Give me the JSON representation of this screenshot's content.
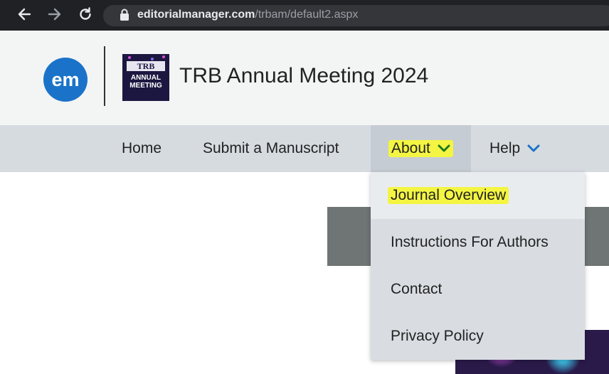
{
  "browser": {
    "url_host": "editorialmanager.com",
    "url_path": "/trbam/default2.aspx"
  },
  "header": {
    "em_logo_text": "em",
    "trb_logo_word": "TRB",
    "trb_logo_sub": "ANNUAL MEETING",
    "title": "TRB Annual Meeting 2024"
  },
  "nav": {
    "items": [
      {
        "label": "Home"
      },
      {
        "label": "Submit a Manuscript"
      },
      {
        "label": "About"
      },
      {
        "label": "Help"
      }
    ]
  },
  "about_menu": {
    "items": [
      {
        "label": "Journal Overview"
      },
      {
        "label": "Instructions For Authors"
      },
      {
        "label": "Contact"
      },
      {
        "label": "Privacy Policy"
      }
    ]
  },
  "colors": {
    "highlight": "#f4f542",
    "nav_bg": "#d6dbe0",
    "accent_chevron": "#1a73c8"
  },
  "icons": [
    "back-arrow-icon",
    "forward-arrow-icon",
    "reload-icon",
    "lock-icon",
    "chevron-down-icon"
  ]
}
